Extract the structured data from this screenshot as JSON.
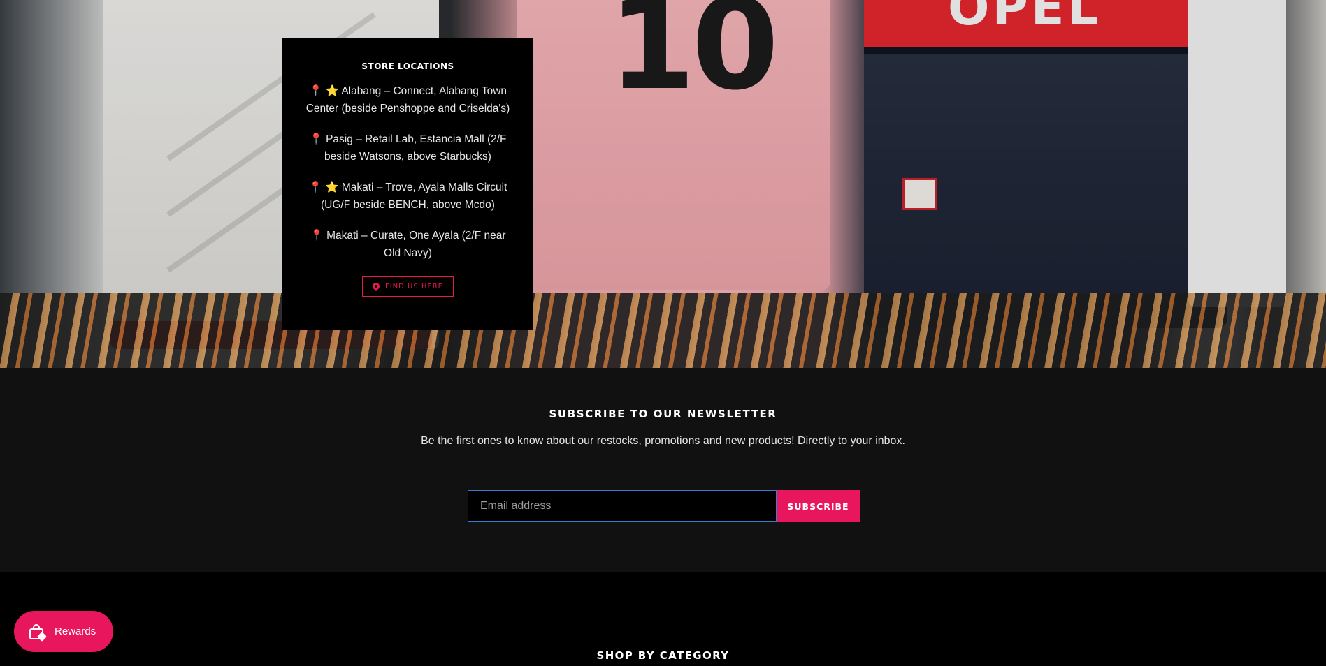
{
  "store_locations": {
    "title": "STORE LOCATIONS",
    "locations": [
      {
        "pin": "📍",
        "star": "⭐",
        "text": "Alabang – Connect, Alabang Town Center (beside Penshoppe and Criselda's)"
      },
      {
        "pin": "📍",
        "star": "",
        "text": "Pasig – Retail Lab, Estancia Mall (2/F beside Watsons, above Starbucks)"
      },
      {
        "pin": "📍",
        "star": "⭐",
        "text": "Makati – Trove, Ayala Malls Circuit (UG/F beside BENCH, above Mcdo)"
      },
      {
        "pin": "📍",
        "star": "",
        "text": "Makati – Curate, One Ayala (2/F near Old Navy)"
      }
    ],
    "find_button": "FIND US HERE",
    "find_icon": "map-pin-icon"
  },
  "newsletter": {
    "title": "SUBSCRIBE TO OUR NEWSLETTER",
    "subtitle": "Be the first ones to know about our restocks, promotions and new products! Directly to your inbox.",
    "email_placeholder": "Email address",
    "subscribe_label": "SUBSCRIBE"
  },
  "footer": {
    "shop_by_category": "SHOP BY CATEGORY"
  },
  "rewards": {
    "label": "Rewards",
    "icon": "shopping-bag-heart-icon"
  },
  "colors": {
    "accent": "#e8175d",
    "panel_bg": "#000000",
    "newsletter_bg": "#111111",
    "input_border": "#3a7bd5"
  }
}
